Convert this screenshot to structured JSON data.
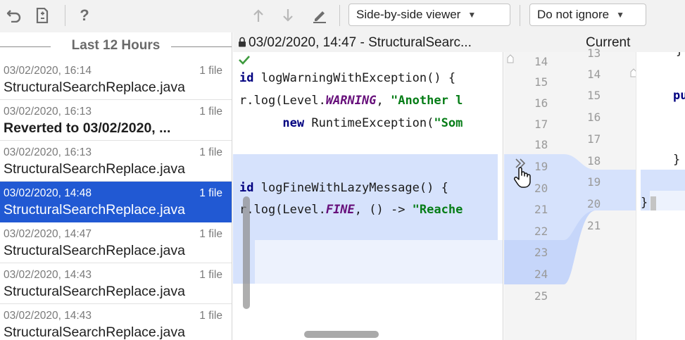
{
  "toolbar": {
    "undo_icon": "undo-icon",
    "patch_icon": "create-patch-icon",
    "help_label": "?",
    "prev_diff_icon": "arrow-up-icon",
    "next_diff_icon": "arrow-down-icon",
    "edit_icon": "pencil-icon",
    "viewer_value": "Side-by-side viewer",
    "ignore_value": "Do not ignore"
  },
  "history": {
    "group_title": "Last 12 Hours",
    "items": [
      {
        "time": "03/02/2020, 16:14",
        "count": "1 file",
        "name": "StructuralSearchReplace.java"
      },
      {
        "time": "03/02/2020, 16:13",
        "count": "1 file",
        "name": "Reverted to 03/02/2020, ..."
      },
      {
        "time": "03/02/2020, 16:13",
        "count": "1 file",
        "name": "StructuralSearchReplace.java"
      },
      {
        "time": "03/02/2020, 14:48",
        "count": "1 file",
        "name": "StructuralSearchReplace.java"
      },
      {
        "time": "03/02/2020, 14:47",
        "count": "1 file",
        "name": "StructuralSearchReplace.java"
      },
      {
        "time": "03/02/2020, 14:43",
        "count": "1 file",
        "name": "StructuralSearchReplace.java"
      },
      {
        "time": "03/02/2020, 14:43",
        "count": "1 file",
        "name": "StructuralSearchReplace.java"
      }
    ]
  },
  "diff": {
    "left_title": "03/02/2020, 14:47 - StructuralSearc...",
    "right_title": "Current",
    "left_code": {
      "l1": {
        "kw": "id",
        "rest": " logWarningWithException() {"
      },
      "l2": {
        "a": "r.log(Level.",
        "it": "WARNING",
        "b": ", ",
        "str": "\"Another l"
      },
      "l3": {
        "pad": "      ",
        "kw": "new",
        "b": " RuntimeException(",
        "str": "\"Som"
      },
      "l4": {
        "kw": "id",
        "rest": " logFineWithLazyMessage() {"
      },
      "l5": {
        "a": "r.log(Level.",
        "it": "FINE",
        "b": ", () -> ",
        "str": "\"Reache"
      }
    },
    "left_lines": [
      "14",
      "15",
      "16",
      "17",
      "18",
      "19",
      "20",
      "21",
      "22",
      "23",
      "24",
      "25"
    ],
    "right_lines": [
      "13",
      "14",
      "15",
      "16",
      "17",
      "18",
      "19",
      "20",
      "21"
    ],
    "right_code": {
      "r0": "}",
      "r1": "pu",
      "r2": "}",
      "r3": "}"
    }
  }
}
